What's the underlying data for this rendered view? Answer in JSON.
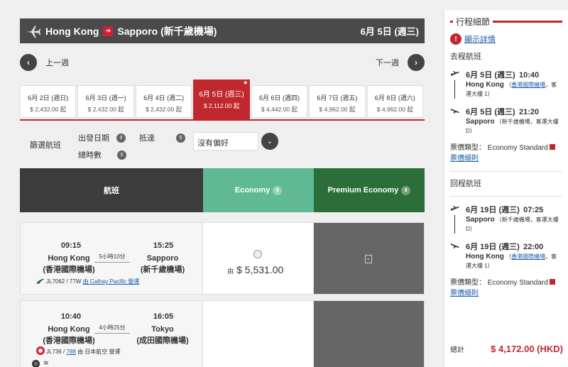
{
  "header": {
    "origin": "Hong Kong",
    "destination": "Sapporo (新千歲機場)",
    "date": "6月 5日 (週三)"
  },
  "week_nav": {
    "prev_label": "上一週",
    "next_label": "下一週"
  },
  "date_tabs": [
    {
      "date": "6月 2日 (週日)",
      "price": "$ 2,432.00 起"
    },
    {
      "date": "6月 3日 (週一)",
      "price": "$ 2,432.00 起"
    },
    {
      "date": "6月 4日 (週二)",
      "price": "$ 2,432.00 起"
    },
    {
      "date": "6月 5日 (週三)",
      "price": "$ 2,112.00 起"
    },
    {
      "date": "6月 6日 (週四)",
      "price": "$ 4,442.00 起"
    },
    {
      "date": "6月 7日 (週五)",
      "price": "$ 4,962.00 起"
    },
    {
      "date": "6月 8日 (週六)",
      "price": "$ 4,962.00 起"
    }
  ],
  "filter": {
    "title": "篩選航班",
    "departure": "出發日期",
    "arrival": "抵達",
    "total_time": "總時數",
    "preference": "沒有偏好"
  },
  "table_header": {
    "flight": "航班",
    "economy": "Economy",
    "premium": "Premium Economy"
  },
  "flights": [
    {
      "dep_time": "09:15",
      "dep_city": "Hong Kong",
      "dep_airport": "(香港國際機場)",
      "arr_time": "15:25",
      "arr_city": "Sapporo",
      "arr_airport": "(新千歲機場)",
      "duration": "5小時10分",
      "flight_no": "JL7062 / 77W",
      "operator_prefix": "由",
      "operator": "Cathay Pacific",
      "operator_suffix": "營運",
      "price_prefix": "由",
      "price": "$ 5,531.00"
    },
    {
      "dep_time": "10:40",
      "dep_city": "Hong Kong",
      "dep_airport": "(香港國際機場)",
      "arr_time": "16:05",
      "arr_city": "Tokyo",
      "arr_airport": "(成田國際機場)",
      "duration": "4小時25分",
      "flight_no": "JL736 / ",
      "aircraft": "788",
      "operator_text": "由 日本航空 營運"
    }
  ],
  "summary": {
    "title": "行程細節",
    "show_details": "顯示詳情",
    "outbound_label": "去程航班",
    "outbound": {
      "dep_date": "6月 5日 (週三)",
      "dep_time": "10:40",
      "dep_city": "Hong Kong",
      "dep_airport": "香港國際機場",
      "dep_terminal": "，客運大樓 1）",
      "arr_date": "6月 5日 (週三)",
      "arr_time": "21:20",
      "arr_city": "Sapporo",
      "arr_detail": "（新千歲機場，客運大樓 D）",
      "fare_type": "票價類型： Economy Standard",
      "fare_rules": "票價細則"
    },
    "return_label": "回程航班",
    "return": {
      "dep_date": "6月 19日 (週三)",
      "dep_time": "07:25",
      "dep_city": "Sapporo",
      "dep_detail": "（新千歲機場，客運大樓 D）",
      "arr_date": "6月 19日 (週三)",
      "arr_time": "22:00",
      "arr_city": "Hong Kong",
      "arr_airport": "香港國際機場",
      "arr_terminal": "，客運大樓 1）",
      "fare_type": "票價類型： Economy Standard",
      "fare_rules": "票價細則"
    },
    "total_label": "總計",
    "total_amount": "$ 4,172.00 (HKD)"
  },
  "colors": {
    "brand_red": "#c0282e",
    "economy": "#5fb992",
    "premium": "#2b6e3a",
    "header": "#4a4a4a"
  }
}
